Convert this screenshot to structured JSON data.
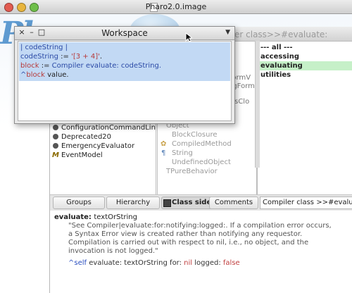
{
  "window": {
    "title": "Pharo2.0.image"
  },
  "desktop": {
    "logo_text": "Pl"
  },
  "browser": {
    "title": "er class>>#evaluate:",
    "packages_partial": [
      "ConfigurationCommandLineH",
      "Deprecated20",
      "EmergencyEvaluator",
      "EventModel"
    ],
    "package_prefix_icons": [
      "class-icon",
      "class-icon",
      "class-icon",
      "trait-icon"
    ],
    "class_partials": [
      {
        "text": "FormV"
      },
      {
        "text": "ngForm"
      },
      {
        "text": "lusClo"
      }
    ],
    "classes": [
      {
        "label": "Object",
        "faded": true
      },
      {
        "label": "BlockClosure",
        "faded": true
      },
      {
        "label": "CompiledMethod",
        "faded": true
      },
      {
        "label": "String",
        "faded": true
      },
      {
        "label": "UndefinedObject",
        "faded": true
      },
      {
        "label": "TPureBehavior",
        "faded": true
      }
    ],
    "protocols": [
      {
        "label": "--- all ---",
        "selected": false
      },
      {
        "label": "accessing",
        "selected": false
      },
      {
        "label": "evaluating",
        "selected": true
      },
      {
        "label": "utilities",
        "selected": false
      }
    ],
    "tabs": {
      "groups": "Groups",
      "hierarchy": "Hierarchy",
      "class_side": "Class side",
      "comments": "Comments"
    },
    "method_label": "Compiler class >>#evaluate:",
    "code": {
      "selector_keyword": "evaluate:",
      "selector_arg": "textOrString",
      "comment_1": "\"See Compiler|evaluate:for:notifying:logged:. If a compilation error occurs,",
      "comment_2": "a Syntax Error view is created rather than notifying any requestor.",
      "comment_3": "Compilation is carried out with respect to nil, i.e., no object, and the",
      "comment_4": "invocation is not logged.\"",
      "ret_caret": "^",
      "ret_self": "self",
      "ret_rest1": " evaluate: textOrString for: ",
      "ret_nil": "nil",
      "ret_rest2": " logged: ",
      "ret_false": "false"
    }
  },
  "workspace": {
    "title": "Workspace",
    "close": "×",
    "minimize": "–",
    "maximize": "□",
    "menu": "▼",
    "lines": {
      "l1": "| codeString |",
      "l2_var": "codeString",
      "l2_op": " := ",
      "l2_str": "'[3 + 4]'",
      "l2_end": ".",
      "l3_var": "block",
      "l3_op": " := ",
      "l3_rest": "Compiler evaluate: codeString.",
      "l4_caret": "^",
      "l4_var": "block",
      "l4_rest": " value."
    }
  }
}
